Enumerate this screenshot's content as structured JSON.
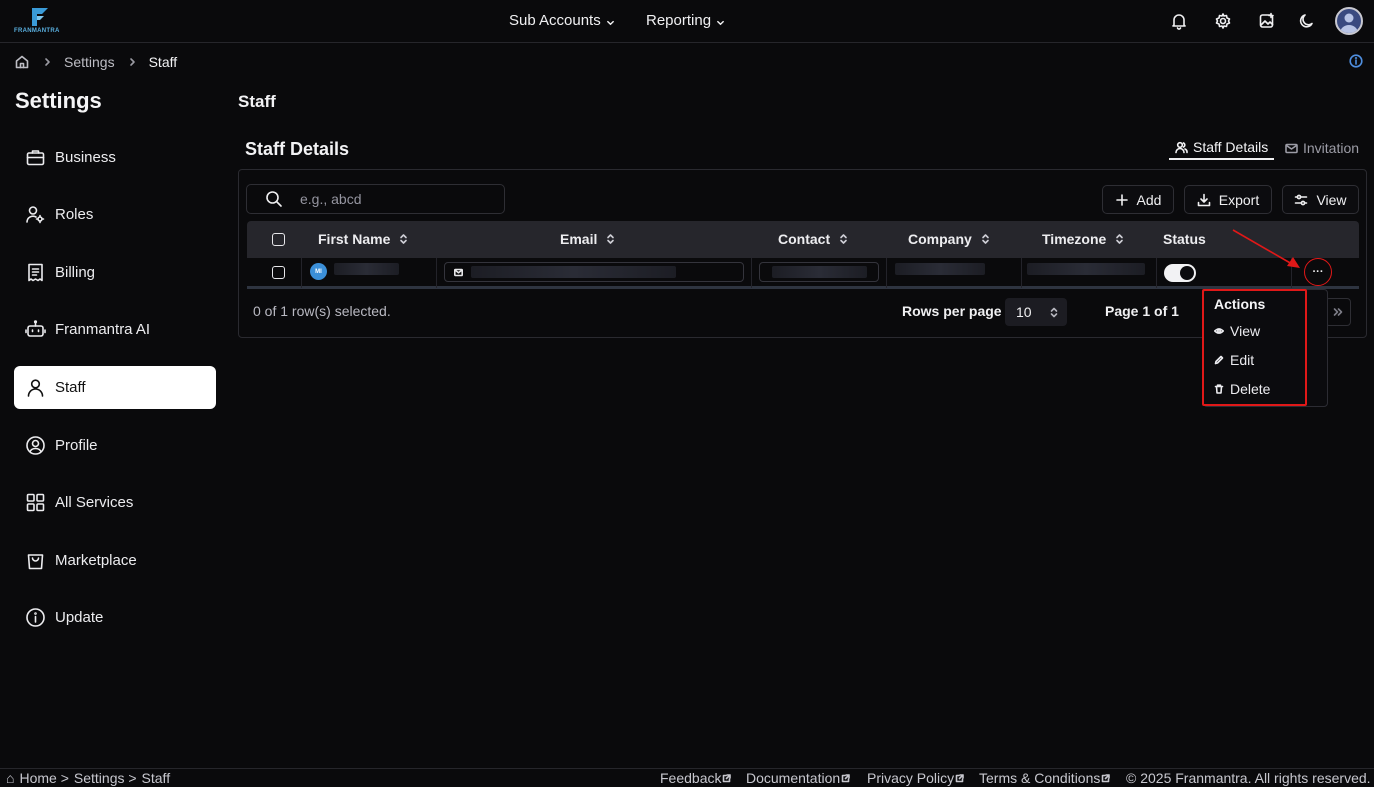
{
  "app": {
    "logo_text": "FRANMANTRA"
  },
  "topnav": {
    "sub_accounts": "Sub Accounts",
    "reporting": "Reporting"
  },
  "header_icons": [
    "bell-icon",
    "gear-icon",
    "image-icon",
    "moon-icon",
    "avatar"
  ],
  "breadcrumb": {
    "items": [
      "Settings",
      "Staff"
    ]
  },
  "sidebar": {
    "title": "Settings",
    "items": [
      {
        "label": "Business",
        "icon": "briefcase-icon"
      },
      {
        "label": "Roles",
        "icon": "user-gear-icon"
      },
      {
        "label": "Billing",
        "icon": "receipt-icon"
      },
      {
        "label": "Franmantra AI",
        "icon": "bot-icon"
      },
      {
        "label": "Staff",
        "icon": "user-icon",
        "active": true
      },
      {
        "label": "Profile",
        "icon": "user-circle-icon"
      },
      {
        "label": "All Services",
        "icon": "grid-icon"
      },
      {
        "label": "Marketplace",
        "icon": "shopping-bag-icon"
      },
      {
        "label": "Update",
        "icon": "info-icon"
      }
    ]
  },
  "main": {
    "page_title": "Staff",
    "section_title": "Staff Details",
    "tabs": [
      {
        "label": "Staff Details",
        "active": true
      },
      {
        "label": "Invitation",
        "active": false
      }
    ],
    "search": {
      "placeholder": "e.g., abcd"
    },
    "toolbar": {
      "add": "Add",
      "export": "Export",
      "view": "View"
    },
    "table": {
      "columns": [
        "First Name",
        "Email",
        "Contact",
        "Company",
        "Timezone",
        "Status"
      ],
      "rows": [
        {
          "avatar_initials": "MI",
          "status_on": true
        }
      ]
    },
    "footer": {
      "selection": "0 of 1 row(s) selected.",
      "rows_per_page_label": "Rows per page",
      "rows_per_page_value": "10",
      "page_info": "Page 1 of 1"
    },
    "actions_menu": {
      "title": "Actions",
      "items": [
        "View",
        "Edit",
        "Delete"
      ]
    }
  },
  "bottom_bar": {
    "breadcrumb": [
      "Home >",
      "Settings >",
      "Staff"
    ],
    "links": [
      "Feedback",
      "Documentation",
      "Privacy Policy",
      "Terms & Conditions"
    ],
    "copyright": "© 2025 Franmantra. All rights reserved."
  },
  "colors": {
    "accent_highlight": "#e01818",
    "brand": "#3b8fd8",
    "background": "#0a0a0c"
  }
}
